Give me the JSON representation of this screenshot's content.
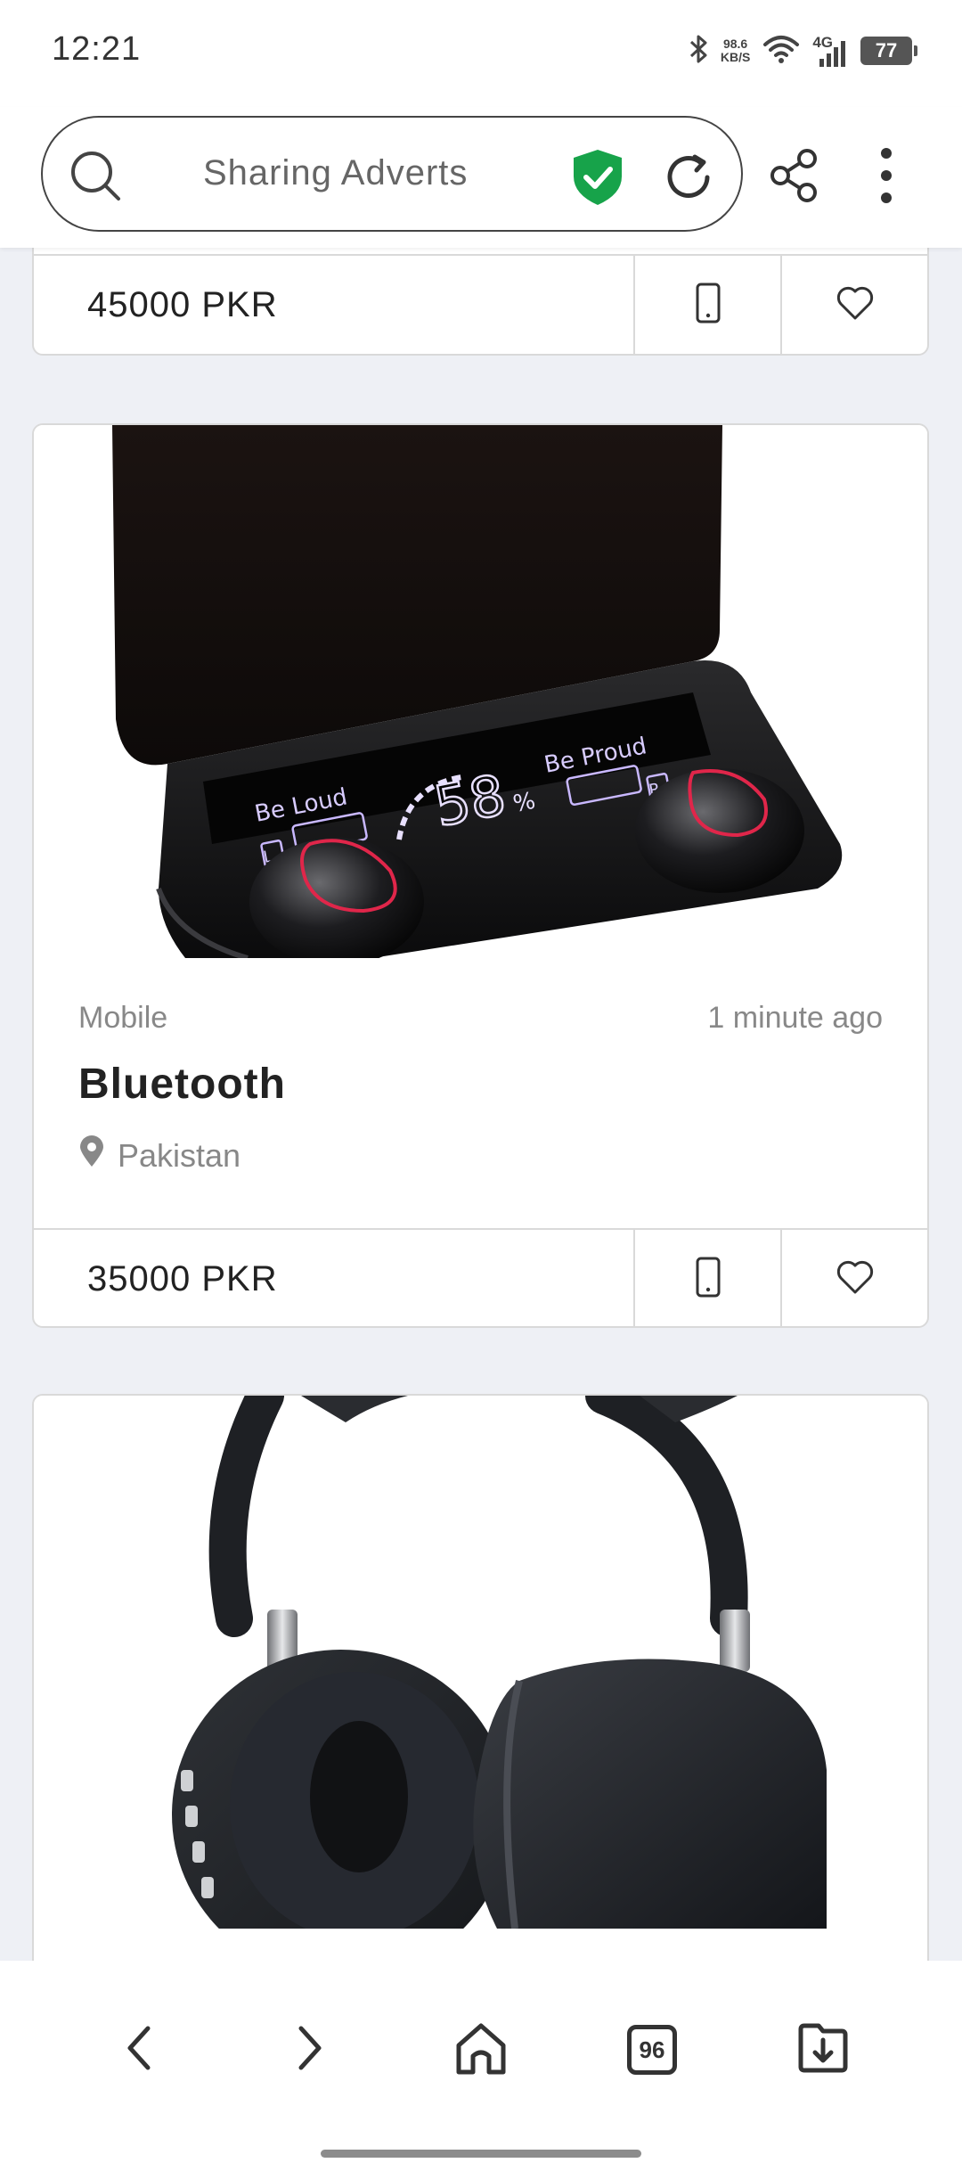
{
  "status_bar": {
    "time": "12:21",
    "speed_value": "98.6",
    "speed_unit": "KB/S",
    "network": "4G",
    "battery": "77",
    "icons": [
      "bluetooth-icon",
      "wifi-icon",
      "signal-icon",
      "battery-icon"
    ]
  },
  "browser": {
    "url_text": "Sharing Adverts",
    "shield_color": "#17a34a"
  },
  "listings": [
    {
      "price": "45000 PKR"
    },
    {
      "category": "Mobile",
      "time_ago": "1 minute ago",
      "title": "Bluetooth",
      "location": "Pakistan",
      "price": "35000 PKR",
      "image_overlay": {
        "left_label": "Be Loud",
        "right_label": "Be Proud",
        "percent": "58",
        "percent_sign": "%",
        "left_marker": "L",
        "right_marker": "R"
      }
    },
    {
      "image": "headphones"
    }
  ],
  "bottom_nav": {
    "tabs_count": "96",
    "icons": [
      "back-arrow-icon",
      "forward-arrow-icon",
      "home-icon",
      "tabs-icon",
      "download-icon"
    ]
  }
}
